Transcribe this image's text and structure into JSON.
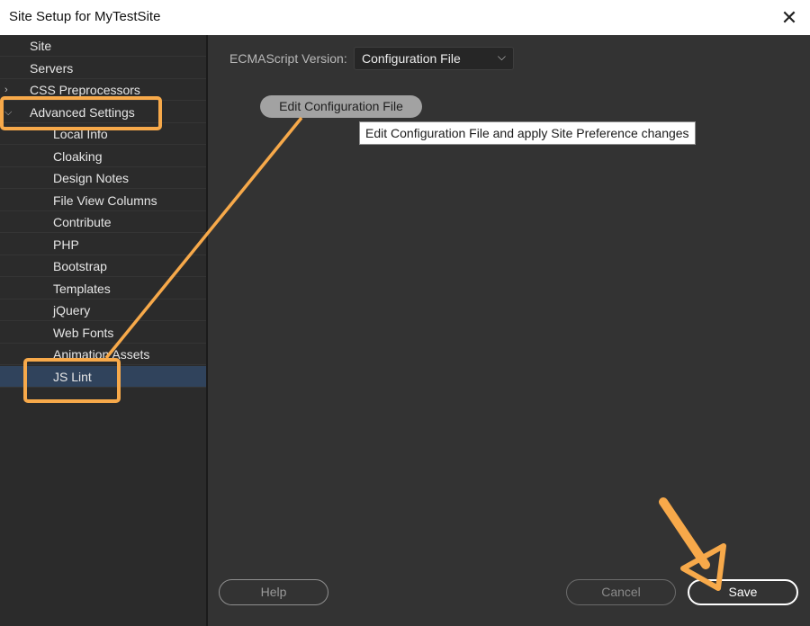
{
  "window": {
    "title": "Site Setup for MyTestSite"
  },
  "sidebar": {
    "items": [
      {
        "label": "Site",
        "level": 0
      },
      {
        "label": "Servers",
        "level": 0
      },
      {
        "label": "CSS Preprocessors",
        "level": 0,
        "expander": "collapsed"
      },
      {
        "label": "Advanced Settings",
        "level": 0,
        "expander": "expanded"
      },
      {
        "label": "Local Info",
        "level": 1
      },
      {
        "label": "Cloaking",
        "level": 1
      },
      {
        "label": "Design Notes",
        "level": 1
      },
      {
        "label": "File View Columns",
        "level": 1
      },
      {
        "label": "Contribute",
        "level": 1
      },
      {
        "label": "PHP",
        "level": 1
      },
      {
        "label": "Bootstrap",
        "level": 1
      },
      {
        "label": "Templates",
        "level": 1
      },
      {
        "label": "jQuery",
        "level": 1
      },
      {
        "label": "Web Fonts",
        "level": 1
      },
      {
        "label": "Animation Assets",
        "level": 1
      },
      {
        "label": "JS Lint",
        "level": 1,
        "selected": true
      }
    ]
  },
  "main": {
    "ecmascript_label": "ECMAScript Version:",
    "ecmascript_value": "Configuration File",
    "edit_button_label": "Edit Configuration File",
    "tooltip_text": "Edit Configuration File and apply Site Preference changes"
  },
  "footer": {
    "help_label": "Help",
    "cancel_label": "Cancel",
    "save_label": "Save"
  },
  "icons": {
    "close": "close-icon",
    "chevron_right": "chevron-right-icon",
    "chevron_down": "chevron-down-icon",
    "select_caret": "chevron-down-icon"
  },
  "colors": {
    "annotation": "#f7a94a",
    "selected_row": "#30435c",
    "background": "#333333"
  }
}
